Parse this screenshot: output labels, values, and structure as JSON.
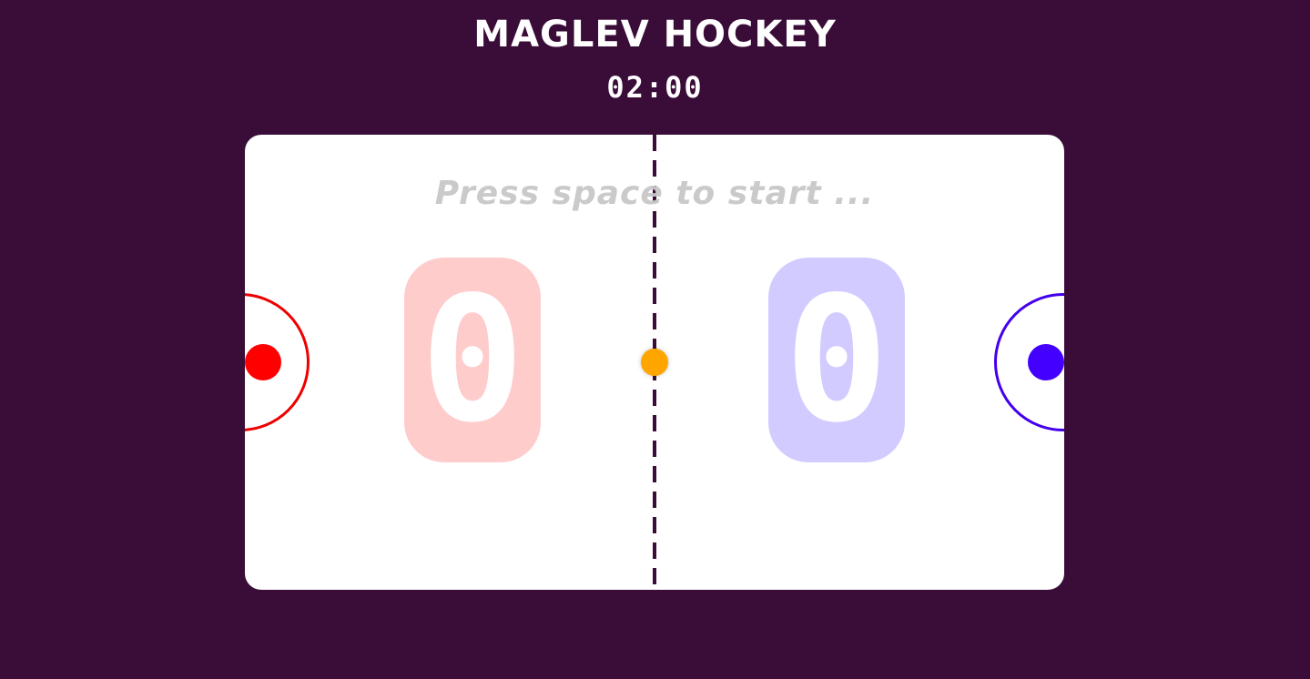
{
  "header": {
    "title": "MAGLEV HOCKEY",
    "timer": "02:00"
  },
  "rink": {
    "prompt": "Press space to start ...",
    "scores": {
      "left": "0",
      "right": "0"
    }
  },
  "colors": {
    "background": "#3a0c38",
    "rink": "#ffffff",
    "left_player": "#ff0000",
    "right_player": "#4400ff",
    "puck": "#ffa500",
    "left_score_bg": "#ffcccc",
    "right_score_bg": "#d2cbff"
  }
}
